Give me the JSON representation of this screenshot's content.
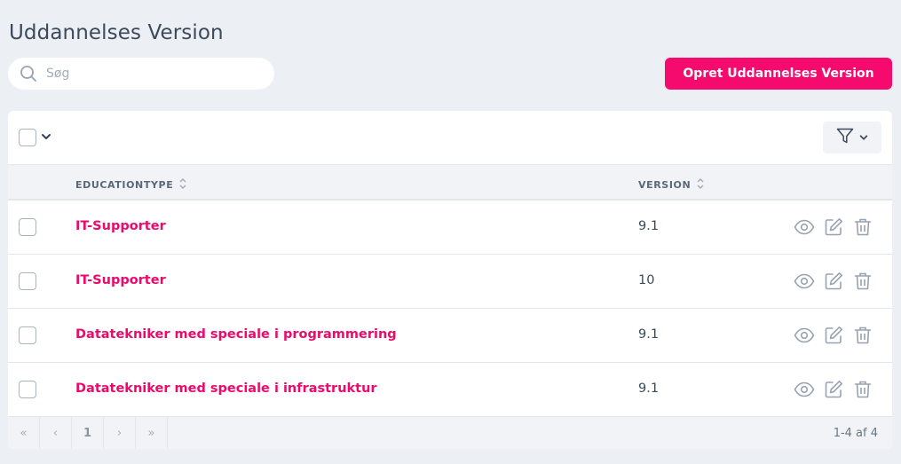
{
  "page": {
    "title": "Uddannelses Version"
  },
  "search": {
    "placeholder": "Søg",
    "icon": "search-icon"
  },
  "actions": {
    "create_label": "Opret Uddannelses Version"
  },
  "table": {
    "columns": [
      {
        "key": "educationtype",
        "label": "EDUCATIONTYPE"
      },
      {
        "key": "version",
        "label": "VERSION"
      }
    ],
    "rows": [
      {
        "educationtype": "IT-Supporter",
        "version": "9.1"
      },
      {
        "educationtype": "IT-Supporter",
        "version": "10"
      },
      {
        "educationtype": "Datatekniker med speciale i programmering",
        "version": "9.1"
      },
      {
        "educationtype": "Datatekniker med speciale i infrastruktur",
        "version": "9.1"
      }
    ],
    "row_actions": [
      "view-icon",
      "edit-icon",
      "delete-icon"
    ]
  },
  "pagination": {
    "first": "«",
    "prev": "‹",
    "current_page": "1",
    "next": "›",
    "last": "»",
    "count_text": "1-4 af 4"
  },
  "colors": {
    "accent": "#f50a6e",
    "link": "#ec0b6c",
    "background": "#eceff3"
  }
}
